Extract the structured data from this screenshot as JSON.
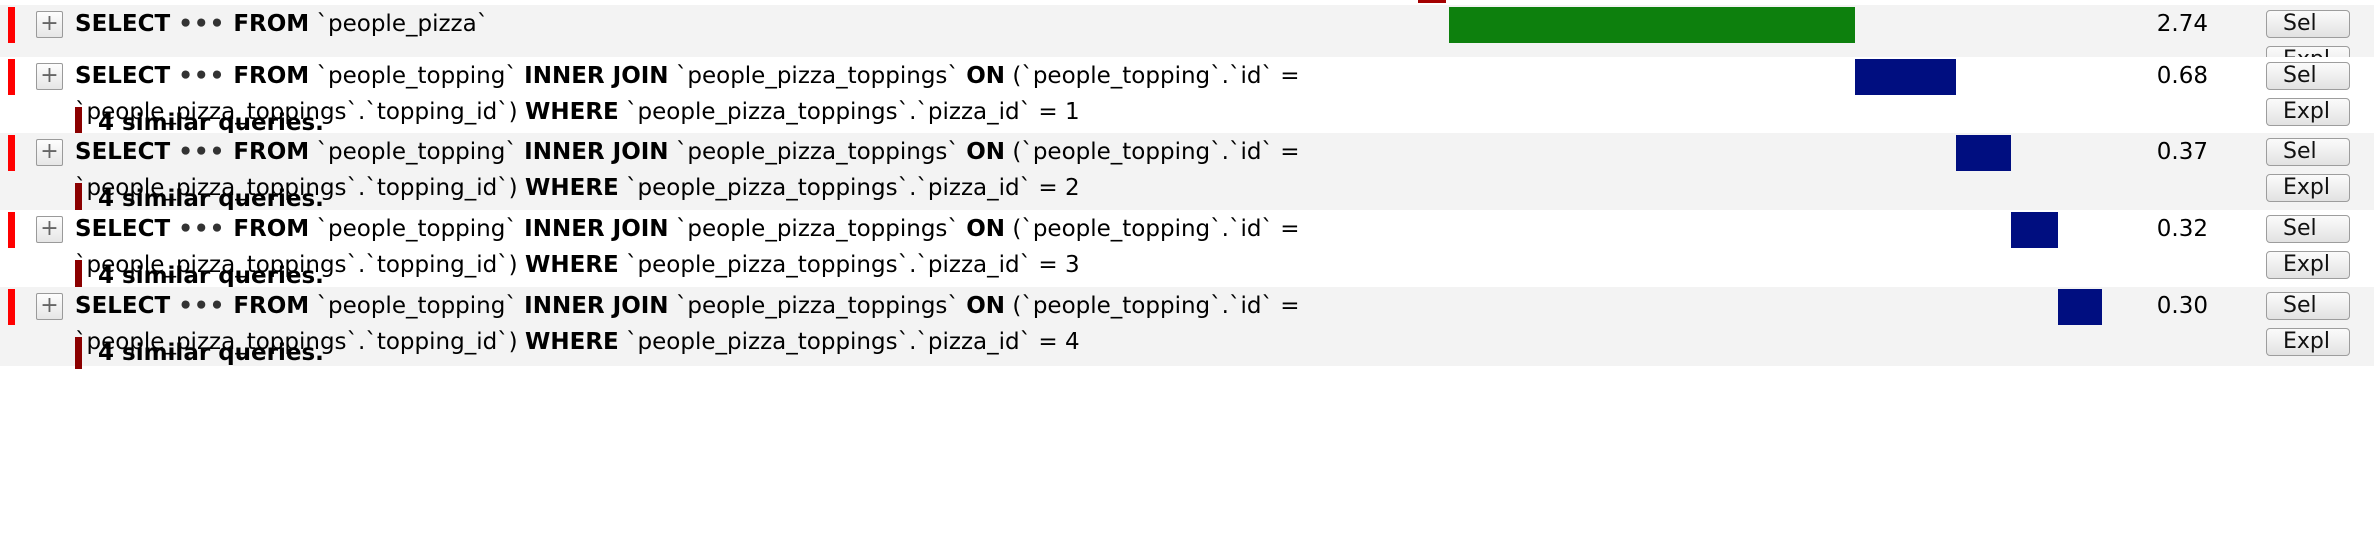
{
  "queries": [
    {
      "toggle": "+",
      "line1": [
        {
          "t": "SELECT",
          "k": true
        },
        {
          "t": "•••",
          "dots": true
        },
        {
          "t": "FROM",
          "k": true
        },
        {
          "t": " `people_pizza`",
          "k": false
        }
      ],
      "line2": null,
      "similar": null,
      "time": "2.74",
      "bar_color": "#0d800d",
      "buttons": [
        "Sel",
        "Expl"
      ]
    },
    {
      "toggle": "+",
      "line1": [
        {
          "t": "SELECT",
          "k": true
        },
        {
          "t": "•••",
          "dots": true
        },
        {
          "t": "FROM",
          "k": true
        },
        {
          "t": " `people_topping` ",
          "k": false
        },
        {
          "t": "INNER JOIN",
          "k": true
        },
        {
          "t": " `people_pizza_toppings` ",
          "k": false
        },
        {
          "t": "ON",
          "k": true
        },
        {
          "t": " (`people_topping`.`id` =",
          "k": false
        }
      ],
      "line2": [
        {
          "t": "`people_pizza_toppings`.`topping_id`) ",
          "k": false
        },
        {
          "t": "WHERE",
          "k": true
        },
        {
          "t": " `people_pizza_toppings`.`pizza_id` = 1",
          "k": false
        }
      ],
      "similar": "4 similar queries.",
      "time": "0.68",
      "bar_color": "#000e80",
      "buttons": [
        "Sel",
        "Expl"
      ]
    },
    {
      "toggle": "+",
      "line1": [
        {
          "t": "SELECT",
          "k": true
        },
        {
          "t": "•••",
          "dots": true
        },
        {
          "t": "FROM",
          "k": true
        },
        {
          "t": " `people_topping` ",
          "k": false
        },
        {
          "t": "INNER JOIN",
          "k": true
        },
        {
          "t": " `people_pizza_toppings` ",
          "k": false
        },
        {
          "t": "ON",
          "k": true
        },
        {
          "t": " (`people_topping`.`id` =",
          "k": false
        }
      ],
      "line2": [
        {
          "t": "`people_pizza_toppings`.`topping_id`) ",
          "k": false
        },
        {
          "t": "WHERE",
          "k": true
        },
        {
          "t": " `people_pizza_toppings`.`pizza_id` = 2",
          "k": false
        }
      ],
      "similar": "4 similar queries.",
      "time": "0.37",
      "bar_color": "#000e80",
      "buttons": [
        "Sel",
        "Expl"
      ]
    },
    {
      "toggle": "+",
      "line1": [
        {
          "t": "SELECT",
          "k": true
        },
        {
          "t": "•••",
          "dots": true
        },
        {
          "t": "FROM",
          "k": true
        },
        {
          "t": " `people_topping` ",
          "k": false
        },
        {
          "t": "INNER JOIN",
          "k": true
        },
        {
          "t": " `people_pizza_toppings` ",
          "k": false
        },
        {
          "t": "ON",
          "k": true
        },
        {
          "t": " (`people_topping`.`id` =",
          "k": false
        }
      ],
      "line2": [
        {
          "t": "`people_pizza_toppings`.`topping_id`) ",
          "k": false
        },
        {
          "t": "WHERE",
          "k": true
        },
        {
          "t": " `people_pizza_toppings`.`pizza_id` = 3",
          "k": false
        }
      ],
      "similar": "4 similar queries.",
      "time": "0.32",
      "bar_color": "#000e80",
      "buttons": [
        "Sel",
        "Expl"
      ]
    },
    {
      "toggle": "+",
      "line1": [
        {
          "t": "SELECT",
          "k": true
        },
        {
          "t": "•••",
          "dots": true
        },
        {
          "t": "FROM",
          "k": true
        },
        {
          "t": " `people_topping` ",
          "k": false
        },
        {
          "t": "INNER JOIN",
          "k": true
        },
        {
          "t": " `people_pizza_toppings` ",
          "k": false
        },
        {
          "t": "ON",
          "k": true
        },
        {
          "t": " (`people_topping`.`id` =",
          "k": false
        }
      ],
      "line2": [
        {
          "t": "`people_pizza_toppings`.`topping_id`) ",
          "k": false
        },
        {
          "t": "WHERE",
          "k": true
        },
        {
          "t": " `people_pizza_toppings`.`pizza_id` = 4",
          "k": false
        }
      ],
      "similar": "4 similar queries.",
      "time": "0.30",
      "bar_color": "#000e80",
      "buttons": [
        "Sel",
        "Expl"
      ]
    }
  ]
}
